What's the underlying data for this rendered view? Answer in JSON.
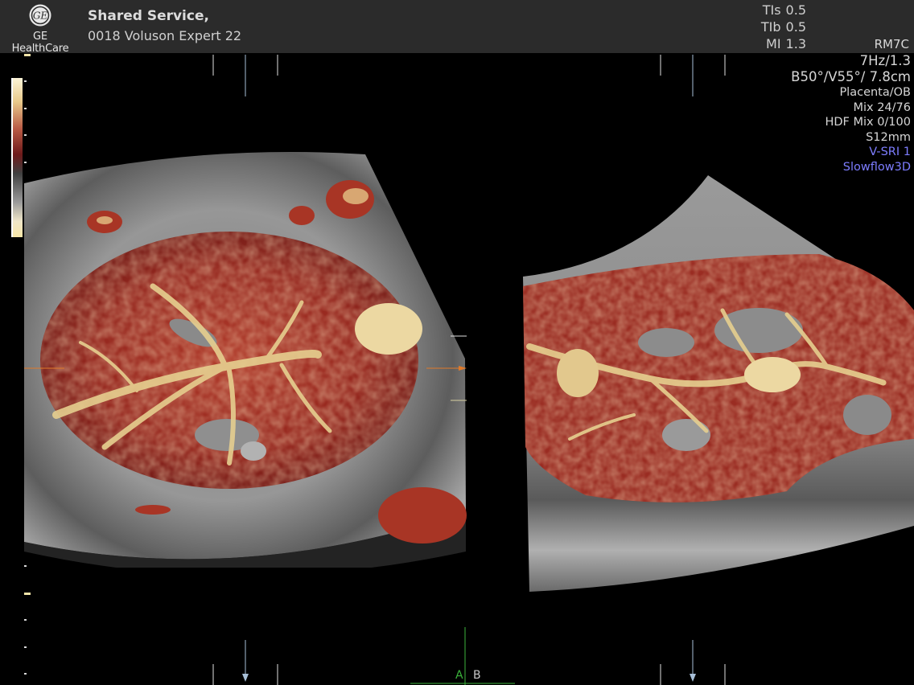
{
  "header": {
    "logo_text": "GE HealthCare",
    "logo_icon": "ge-monogram-icon",
    "site_name": "Shared Service,",
    "device": "0018 Voluson Expert 22"
  },
  "acoustic": [
    {
      "label": "TIs",
      "value": "0.5"
    },
    {
      "label": "TIb",
      "value": "0.5"
    },
    {
      "label": "MI",
      "value": "1.3"
    }
  ],
  "probe": "RM7C",
  "params": {
    "frame_rate": "7Hz/1.3",
    "angles": "B50°/V55°/ 7.8cm",
    "preset": "Placenta/OB",
    "mix": "Mix 24/76",
    "hdf_mix": "HDF Mix 0/100",
    "slice": "S12mm",
    "vsri": "V-SRI 1",
    "mode": "Slowflow3D"
  },
  "views": {
    "label_a": "A",
    "label_b": "B"
  },
  "colors": {
    "vessel_dark": "#7a1c18",
    "vessel_mid": "#b2402e",
    "vessel_light": "#e9d49a",
    "tissue": "#8c8c8c",
    "accent_blue": "#7d7dff",
    "orange_marker": "#e07a2a",
    "green_marker": "#3bb33b"
  }
}
